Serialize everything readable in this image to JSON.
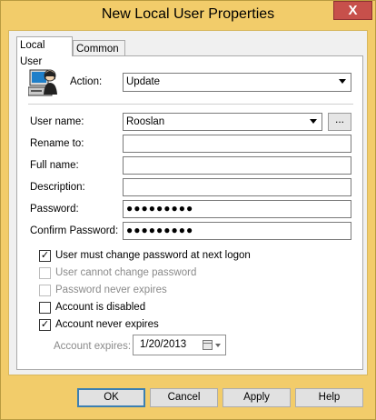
{
  "window": {
    "title": "New Local User Properties",
    "close_label": "X"
  },
  "tabs": [
    {
      "label": "Local User"
    },
    {
      "label": "Common"
    }
  ],
  "form": {
    "action_label": "Action:",
    "action_value": "Update",
    "user_name_label": "User name:",
    "user_name_value": "Rooslan",
    "browse_label": "...",
    "rename_label": "Rename to:",
    "rename_value": "",
    "full_name_label": "Full name:",
    "full_name_value": "",
    "description_label": "Description:",
    "description_value": "",
    "password_label": "Password:",
    "password_value": "●●●●●●●●●",
    "confirm_label": "Confirm Password:",
    "confirm_value": "●●●●●●●●●"
  },
  "checkboxes": [
    {
      "label": "User must change password at next logon",
      "checked": true,
      "enabled": true
    },
    {
      "label": "User cannot change password",
      "checked": false,
      "enabled": false
    },
    {
      "label": "Password never expires",
      "checked": false,
      "enabled": false
    },
    {
      "label": "Account is disabled",
      "checked": false,
      "enabled": true
    },
    {
      "label": "Account never expires",
      "checked": true,
      "enabled": true
    }
  ],
  "expires": {
    "label": "Account expires:",
    "value": "1/20/2013"
  },
  "buttons": {
    "ok": "OK",
    "cancel": "Cancel",
    "apply": "Apply",
    "help": "Help"
  },
  "colors": {
    "title_bar": "#f2cc6a",
    "close_button": "#c7504b",
    "default_button_border": "#3c7fb1"
  }
}
